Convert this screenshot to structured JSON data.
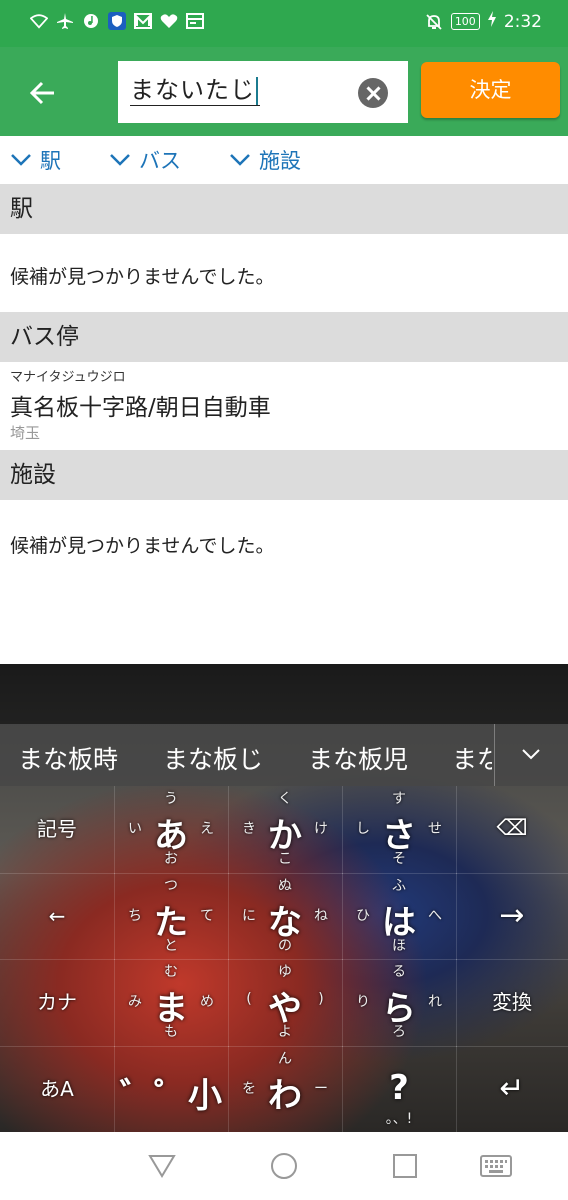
{
  "status_bar": {
    "time": "2:32",
    "battery": "100",
    "icons": [
      "wifi-icon",
      "airplane-icon",
      "music-icon",
      "shield-icon",
      "mail-icon",
      "heart-icon",
      "calendar-icon",
      "mute-bell-icon",
      "charging-icon"
    ]
  },
  "app_bar": {
    "search_value": "まないたじ",
    "decide_label": "決定"
  },
  "filters": [
    {
      "label": "駅"
    },
    {
      "label": "バス"
    },
    {
      "label": "施設"
    }
  ],
  "sections": {
    "station": {
      "header": "駅",
      "message": "候補が見つかりませんでした。"
    },
    "bus": {
      "header": "バス停",
      "item": {
        "ruby": "マナイタジュウジロ",
        "name": "真名板十字路/朝日自動車",
        "prefecture": "埼玉"
      }
    },
    "facility": {
      "header": "施設",
      "message": "候補が見つかりませんでした。"
    }
  },
  "keyboard": {
    "suggestions": [
      "まな板時",
      "まな板じ",
      "まな板児",
      "まな"
    ],
    "left_keys": [
      "記号",
      "←",
      "カナ",
      "あA"
    ],
    "right_keys": [
      "⌫",
      "→",
      "変換",
      "↵"
    ],
    "kana": [
      {
        "main": "あ",
        "up": "う",
        "left": "い",
        "right": "え",
        "down": "お"
      },
      {
        "main": "か",
        "up": "く",
        "left": "き",
        "right": "け",
        "down": "こ"
      },
      {
        "main": "さ",
        "up": "す",
        "left": "し",
        "right": "せ",
        "down": "そ"
      },
      {
        "main": "た",
        "up": "つ",
        "left": "ち",
        "right": "て",
        "down": "と"
      },
      {
        "main": "な",
        "up": "ぬ",
        "left": "に",
        "right": "ね",
        "down": "の"
      },
      {
        "main": "は",
        "up": "ふ",
        "left": "ひ",
        "right": "へ",
        "down": "ほ"
      },
      {
        "main": "ま",
        "up": "む",
        "left": "み",
        "right": "め",
        "down": "も"
      },
      {
        "main": "や",
        "up": "ゆ",
        "left": "(",
        "right": ")",
        "down": "よ"
      },
      {
        "main": "ら",
        "up": "る",
        "left": "り",
        "right": "れ",
        "down": "ろ"
      },
      {
        "main": "゛゜小",
        "up": "",
        "left": "",
        "right": "",
        "down": ""
      },
      {
        "main": "わ",
        "up": "ん",
        "left": "を",
        "right": "ー",
        "down": ""
      },
      {
        "main": "?",
        "up": "",
        "left": "",
        "right": "",
        "down": "。、!"
      }
    ]
  }
}
